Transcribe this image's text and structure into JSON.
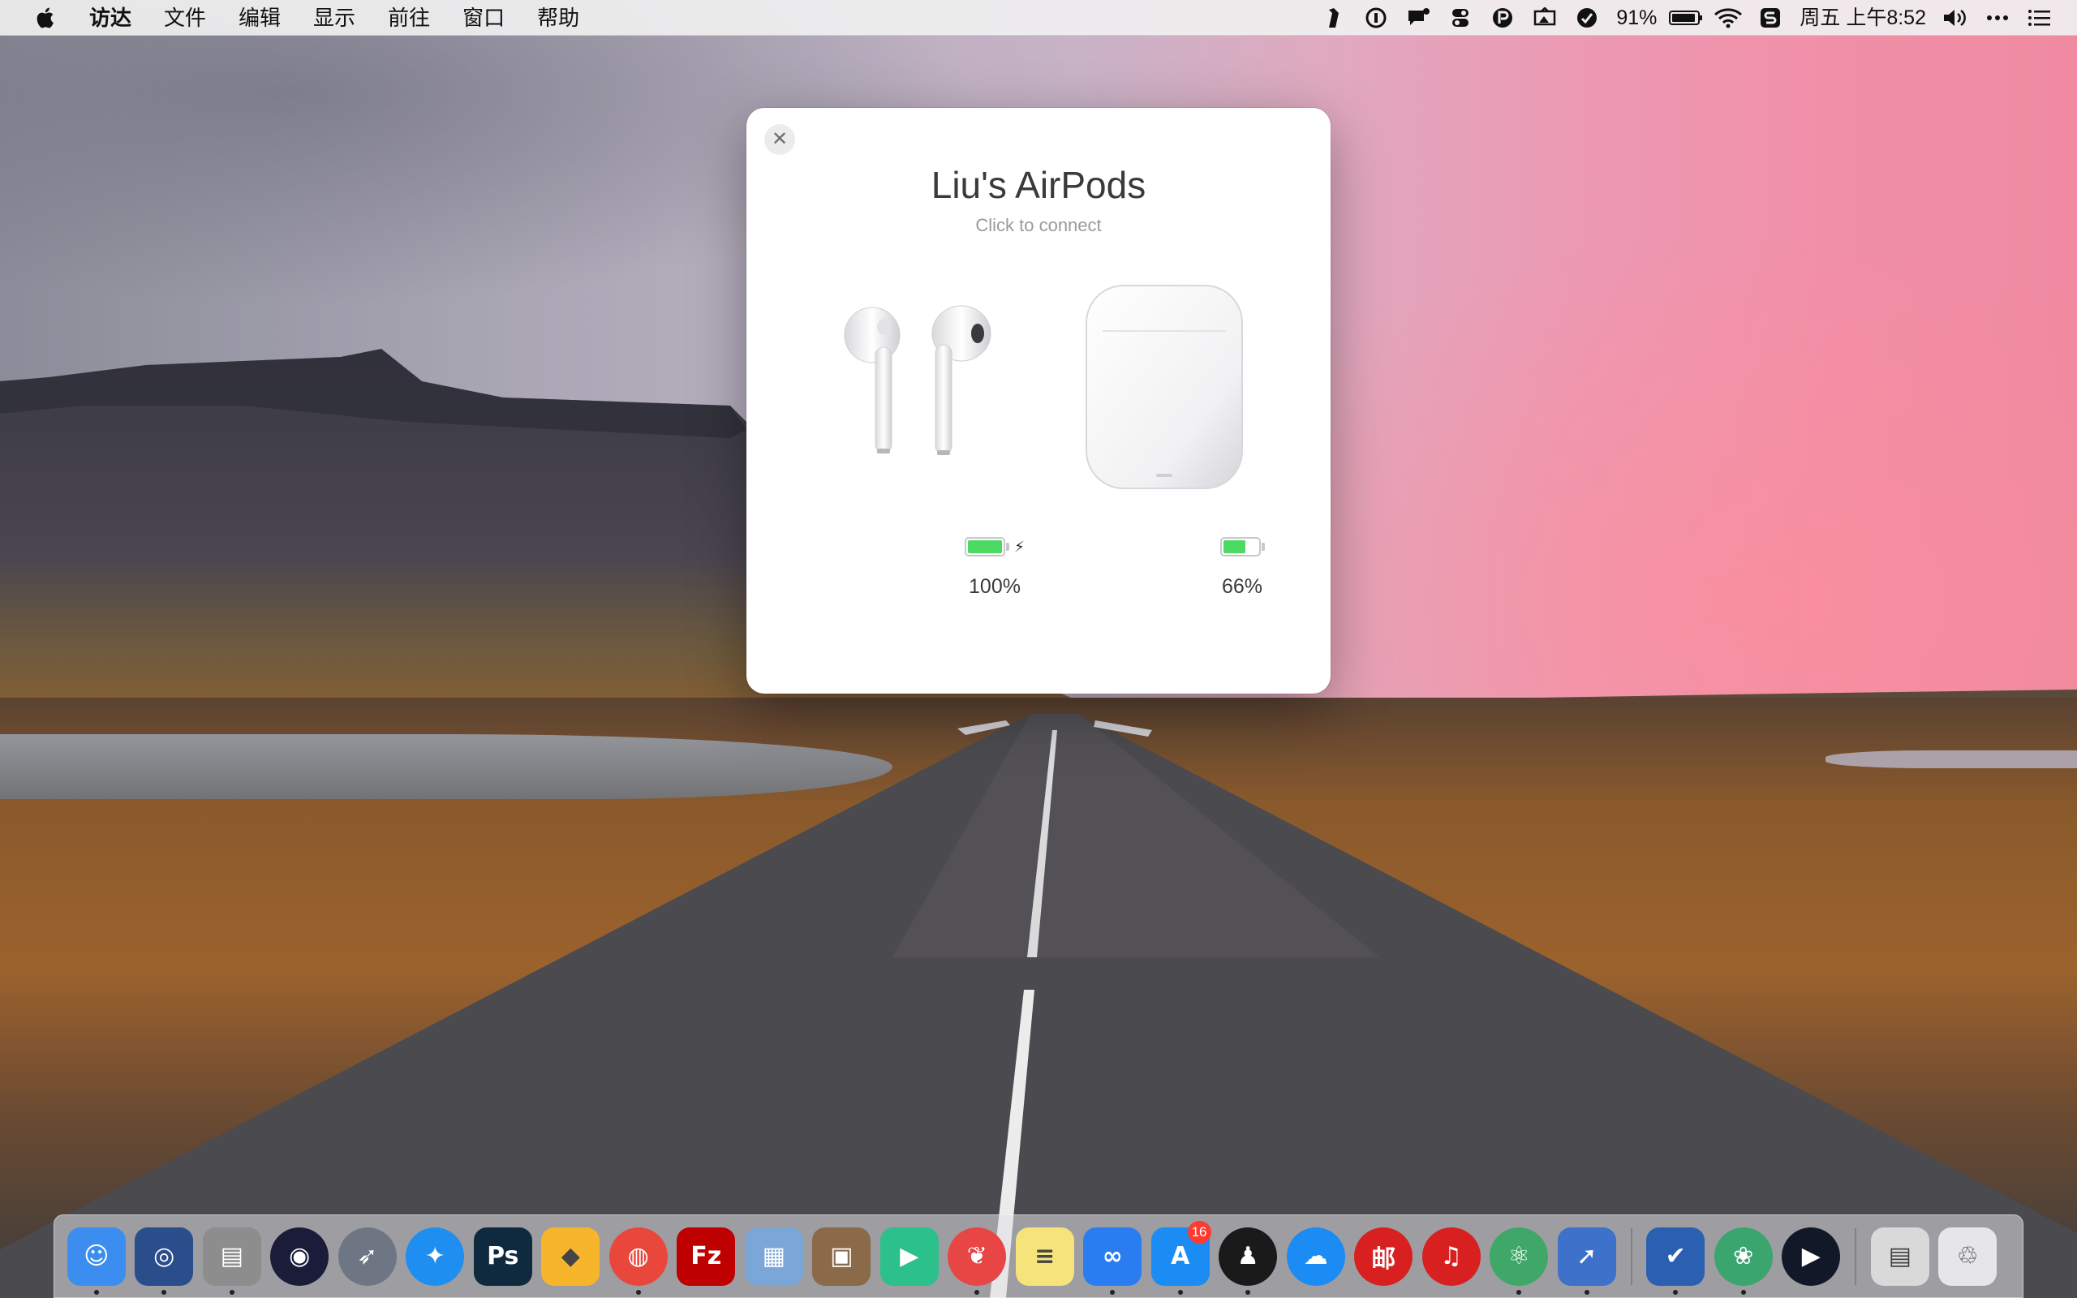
{
  "menubar": {
    "apple_icon": "apple-logo-icon",
    "app_name": "访达",
    "items": [
      "文件",
      "编辑",
      "显示",
      "前往",
      "窗口",
      "帮助"
    ],
    "battery_percent": "91%",
    "clock": "周五 上午8:52",
    "tray_icons": [
      "bartender-icon",
      "1password-icon",
      "notification-icon",
      "toggle-icon",
      "paste-icon",
      "airplay-icon",
      "app-icon",
      "battery-icon",
      "wifi-icon",
      "sogou-input-icon",
      "volume-icon",
      "more-icon",
      "list-icon"
    ]
  },
  "popup": {
    "title": "Liu's AirPods",
    "subtitle": "Click to connect",
    "close_glyph": "✕",
    "left_device": {
      "icon": "airpods-earbuds-icon",
      "battery_level": 100,
      "battery_label": "100%",
      "charging": true
    },
    "right_device": {
      "icon": "airpods-case-icon",
      "battery_level": 66,
      "battery_label": "66%",
      "charging": false
    }
  },
  "colors": {
    "battery_green": "#4cd964",
    "badge_red": "#ff3b30",
    "popup_bg": "#ffffff"
  },
  "dock": {
    "apps": [
      {
        "name": "finder",
        "glyph": "☺",
        "bg": "#3b8ef0",
        "running": true
      },
      {
        "name": "network-radar",
        "glyph": "◎",
        "bg": "#2a4d8c",
        "running": true
      },
      {
        "name": "scanner",
        "glyph": "▤",
        "bg": "#8d8d8d",
        "running": true
      },
      {
        "name": "siri",
        "glyph": "◉",
        "bg": "#1b1b3a",
        "round": true,
        "running": false
      },
      {
        "name": "launchpad",
        "glyph": "➶",
        "bg": "#6e7684",
        "round": true,
        "running": false
      },
      {
        "name": "safari",
        "glyph": "✦",
        "bg": "#1f8ef1",
        "round": true,
        "running": false
      },
      {
        "name": "photoshop",
        "glyph": "Ps",
        "bg": "#0f2a3f",
        "running": false
      },
      {
        "name": "sketch",
        "glyph": "◆",
        "bg": "#f7b52c",
        "running": false
      },
      {
        "name": "chrome",
        "glyph": "◍",
        "bg": "#e9473c",
        "round": true,
        "running": true
      },
      {
        "name": "filezilla",
        "glyph": "Fz",
        "bg": "#bf0000",
        "running": false
      },
      {
        "name": "preview",
        "glyph": "▦",
        "bg": "#7aa7d8",
        "running": false
      },
      {
        "name": "keka",
        "glyph": "▣",
        "bg": "#8a6a48",
        "running": false
      },
      {
        "name": "infuse",
        "glyph": "▶",
        "bg": "#2cc08b",
        "running": false
      },
      {
        "name": "bear",
        "glyph": "❦",
        "bg": "#e84545",
        "round": true,
        "running": true
      },
      {
        "name": "notes",
        "glyph": "≡",
        "bg": "#f6e37a",
        "running": false
      },
      {
        "name": "baidu-netdisk",
        "glyph": "∞",
        "bg": "#2a7df0",
        "running": true
      },
      {
        "name": "app-store",
        "glyph": "A",
        "bg": "#1a8cf3",
        "running": true,
        "badge": "16"
      },
      {
        "name": "qq",
        "glyph": "♟",
        "bg": "#1a1a1a",
        "round": true,
        "running": true
      },
      {
        "name": "icloud",
        "glyph": "☁",
        "bg": "#1a8cf3",
        "round": true,
        "running": false
      },
      {
        "name": "mail-master",
        "glyph": "邮",
        "bg": "#d7201f",
        "round": true,
        "running": false
      },
      {
        "name": "netease-music",
        "glyph": "♫",
        "bg": "#d7201f",
        "round": true,
        "running": false
      },
      {
        "name": "atom",
        "glyph": "⚛",
        "bg": "#3fa768",
        "round": true,
        "running": true
      },
      {
        "name": "rocket-typist",
        "glyph": "➚",
        "bg": "#3e71c9",
        "running": true
      },
      {
        "name": "omnifocus",
        "glyph": "✔",
        "bg": "#2b5fb1",
        "running": true
      },
      {
        "name": "wechat-mini",
        "glyph": "❀",
        "bg": "#3aa56f",
        "round": true,
        "running": true
      },
      {
        "name": "iina",
        "glyph": "▶",
        "bg": "#111827",
        "round": true,
        "running": false
      },
      {
        "name": "downloads-stack",
        "glyph": "▤",
        "bg": "#d9d9d9",
        "running": false
      },
      {
        "name": "trash",
        "glyph": "♲",
        "bg": "#e6e6ea",
        "running": false
      }
    ]
  }
}
